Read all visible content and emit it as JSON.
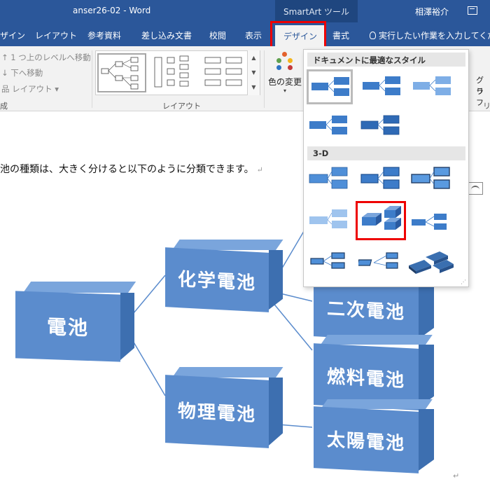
{
  "titlebar": {
    "document_title": "anser26-02  -  Word",
    "context_tool": "SmartArt ツール",
    "user_name": "相澤裕介"
  },
  "tabs": [
    {
      "id": "design_left",
      "label": "ザイン"
    },
    {
      "id": "layout",
      "label": "レイアウト"
    },
    {
      "id": "references",
      "label": "参考資料"
    },
    {
      "id": "mailings",
      "label": "差し込み文書"
    },
    {
      "id": "review",
      "label": "校閲"
    },
    {
      "id": "view",
      "label": "表示"
    },
    {
      "id": "smartart_design",
      "label": "デザイン",
      "active": true
    },
    {
      "id": "format",
      "label": "書式"
    }
  ],
  "tellme": {
    "placeholder": "実行したい作業を入力してください"
  },
  "ribbon": {
    "create_graphic": {
      "move_up": "1 つ上のレベルへ移動",
      "move_down": "下へ移動",
      "layout": "レイアウト",
      "group_label": "成"
    },
    "layouts": {
      "group_label": "レイアウト"
    },
    "color_change": {
      "label": "色の変更"
    },
    "right_partial": {
      "line1": "グラフ",
      "line2": "リ",
      "group": "リ"
    }
  },
  "document": {
    "body_text": "池の種類は、大きく分けると以下のように分類できます。",
    "return_mark": "↵"
  },
  "diagram": {
    "root": "電池",
    "level1": [
      "化学電池",
      "物理電池"
    ],
    "level2": [
      "二次電池",
      "燃料電池",
      "太陽電池"
    ]
  },
  "style_panel": {
    "section_best": "ドキュメントに最適なスタイル",
    "section_3d": "3-D"
  },
  "colors": {
    "word_blue": "#2b579a",
    "box_front": "#5b8ccd",
    "box_top": "#7aa5dc",
    "box_side": "#3d6fb0",
    "highlight": "#ee0000"
  }
}
